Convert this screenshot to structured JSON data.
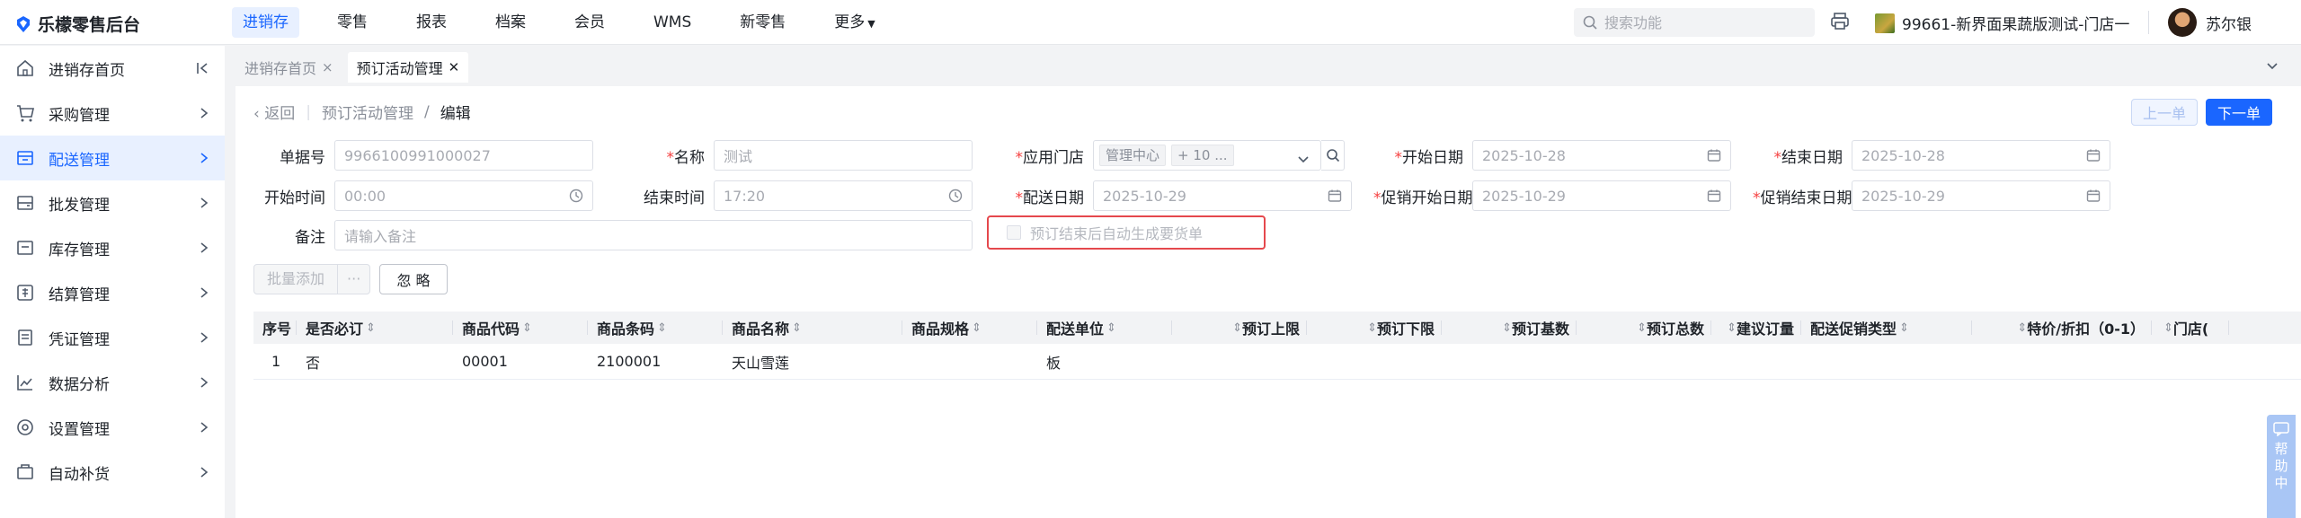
{
  "brand": {
    "title": "乐檬零售后台"
  },
  "topnav": {
    "items": [
      "进销存",
      "零售",
      "报表",
      "档案",
      "会员",
      "WMS",
      "新零售",
      "更多"
    ],
    "active": 0
  },
  "search": {
    "placeholder": "搜索功能"
  },
  "store": {
    "name": "99661-新界面果蔬版测试-门店一"
  },
  "user": {
    "name": "苏尔银"
  },
  "sidebar": {
    "items": [
      {
        "label": "进销存首页",
        "icon": "home-icon"
      },
      {
        "label": "采购管理",
        "icon": "cart-icon"
      },
      {
        "label": "配送管理",
        "icon": "delivery-icon"
      },
      {
        "label": "批发管理",
        "icon": "wholesale-icon"
      },
      {
        "label": "库存管理",
        "icon": "inventory-icon"
      },
      {
        "label": "结算管理",
        "icon": "settlement-icon"
      },
      {
        "label": "凭证管理",
        "icon": "voucher-icon"
      },
      {
        "label": "数据分析",
        "icon": "chart-icon"
      },
      {
        "label": "设置管理",
        "icon": "settings-icon"
      },
      {
        "label": "自动补货",
        "icon": "replenish-icon"
      }
    ],
    "active": 2
  },
  "tabs": [
    {
      "label": "进销存首页",
      "active": false
    },
    {
      "label": "预订活动管理",
      "active": true
    }
  ],
  "breadcrumb": {
    "back": "返回",
    "parent": "预订活动管理",
    "sep": "/",
    "current": "编辑"
  },
  "nav_buttons": {
    "prev": "上一单",
    "next": "下一单"
  },
  "form": {
    "doc_no": {
      "label": "单据号",
      "value": "9966100991000027"
    },
    "name": {
      "label": "名称",
      "value": "测试"
    },
    "store": {
      "label": "应用门店",
      "tag1": "管理中心",
      "tag2": "+ 10 ..."
    },
    "start_date": {
      "label": "开始日期",
      "value": "2025-10-28"
    },
    "end_date": {
      "label": "结束日期",
      "value": "2025-10-28"
    },
    "start_time": {
      "label": "开始时间",
      "value": "00:00"
    },
    "end_time": {
      "label": "结束时间",
      "value": "17:20"
    },
    "delivery_date": {
      "label": "配送日期",
      "value": "2025-10-29"
    },
    "promo_start": {
      "label": "促销开始日期",
      "value": "2025-10-29"
    },
    "promo_end": {
      "label": "促销结束日期",
      "value": "2025-10-29"
    },
    "remark": {
      "label": "备注",
      "placeholder": "请输入备注"
    },
    "auto_order": {
      "label": "预订结束后自动生成要货单",
      "checked": false
    }
  },
  "actions": {
    "batch_add": "批量添加",
    "more": "···",
    "ignore": "忽 略"
  },
  "table": {
    "columns": [
      "序号",
      "是否必订",
      "商品代码",
      "商品条码",
      "商品名称",
      "商品规格",
      "配送单位",
      "预订上限",
      "预订下限",
      "预订基数",
      "预订总数",
      "建议订量",
      "配送促销类型",
      "特价/折扣（0-1）",
      "门店("
    ],
    "rows": [
      [
        "1",
        "否",
        "00001",
        "2100001",
        "天山雪莲",
        "",
        "板",
        "",
        "",
        "",
        "",
        "",
        "",
        "",
        ""
      ]
    ]
  },
  "help": {
    "label": "帮助中"
  }
}
